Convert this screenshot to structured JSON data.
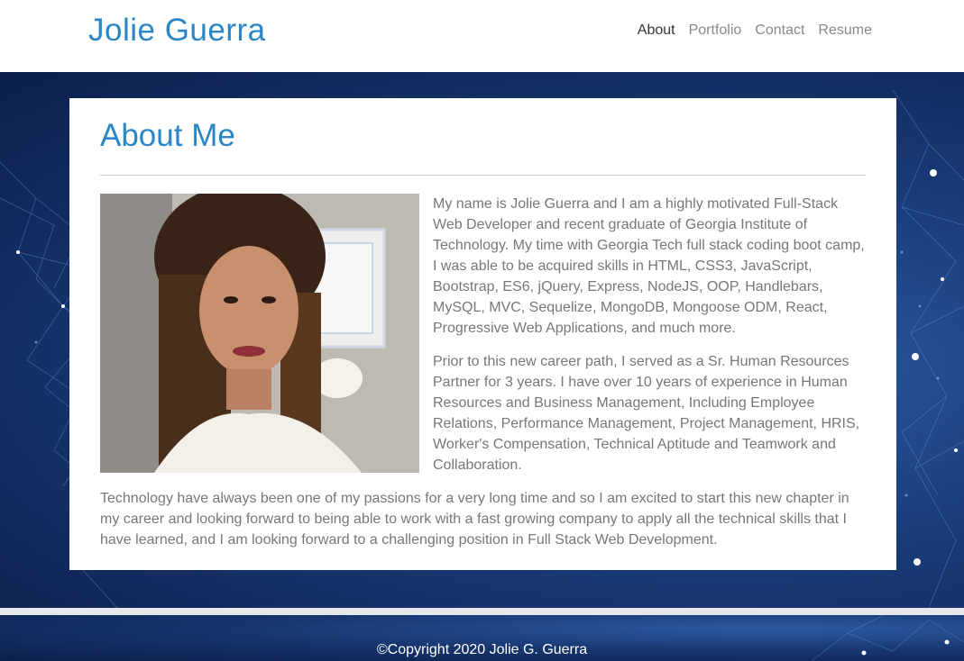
{
  "header": {
    "brand": "Jolie Guerra",
    "nav": [
      {
        "label": "About",
        "active": true
      },
      {
        "label": "Portfolio",
        "active": false
      },
      {
        "label": "Contact",
        "active": false
      },
      {
        "label": "Resume",
        "active": false
      }
    ]
  },
  "about": {
    "title": "About Me",
    "photo_icon": "profile-photo",
    "paragraphs": [
      "My name is Jolie Guerra and I am a highly motivated Full-Stack Web Developer and recent graduate of Georgia Institute of Technology. My time with Georgia Tech full stack coding boot camp, I was able to be acquired skills in HTML, CSS3, JavaScript, Bootstrap, ES6, jQuery, Express, NodeJS, OOP, Handlebars, MySQL, MVC, Sequelize, MongoDB, Mongoose ODM, React, Progressive Web Applications, and much more.",
      "Prior to this new career path, I served as a Sr. Human Resources Partner for 3 years. I have over 10 years of experience in Human Resources and Business Management, Including Employee Relations, Performance Management, Project Management, HRIS, Worker's Compensation, Technical Aptitude and Teamwork and Collaboration.",
      "Technology have always been one of my passions for a very long time and so I am excited to start this new chapter in my career and looking forward to being able to work with a fast growing company to apply all the technical skills that I have learned, and I am looking forward to a challenging position in Full Stack Web Development."
    ]
  },
  "footer": {
    "copyright": "©Copyright 2020 Jolie G. Guerra"
  },
  "colors": {
    "accent": "#2b86c5",
    "hero_background": "#1a3b78",
    "body_text": "#777777"
  }
}
